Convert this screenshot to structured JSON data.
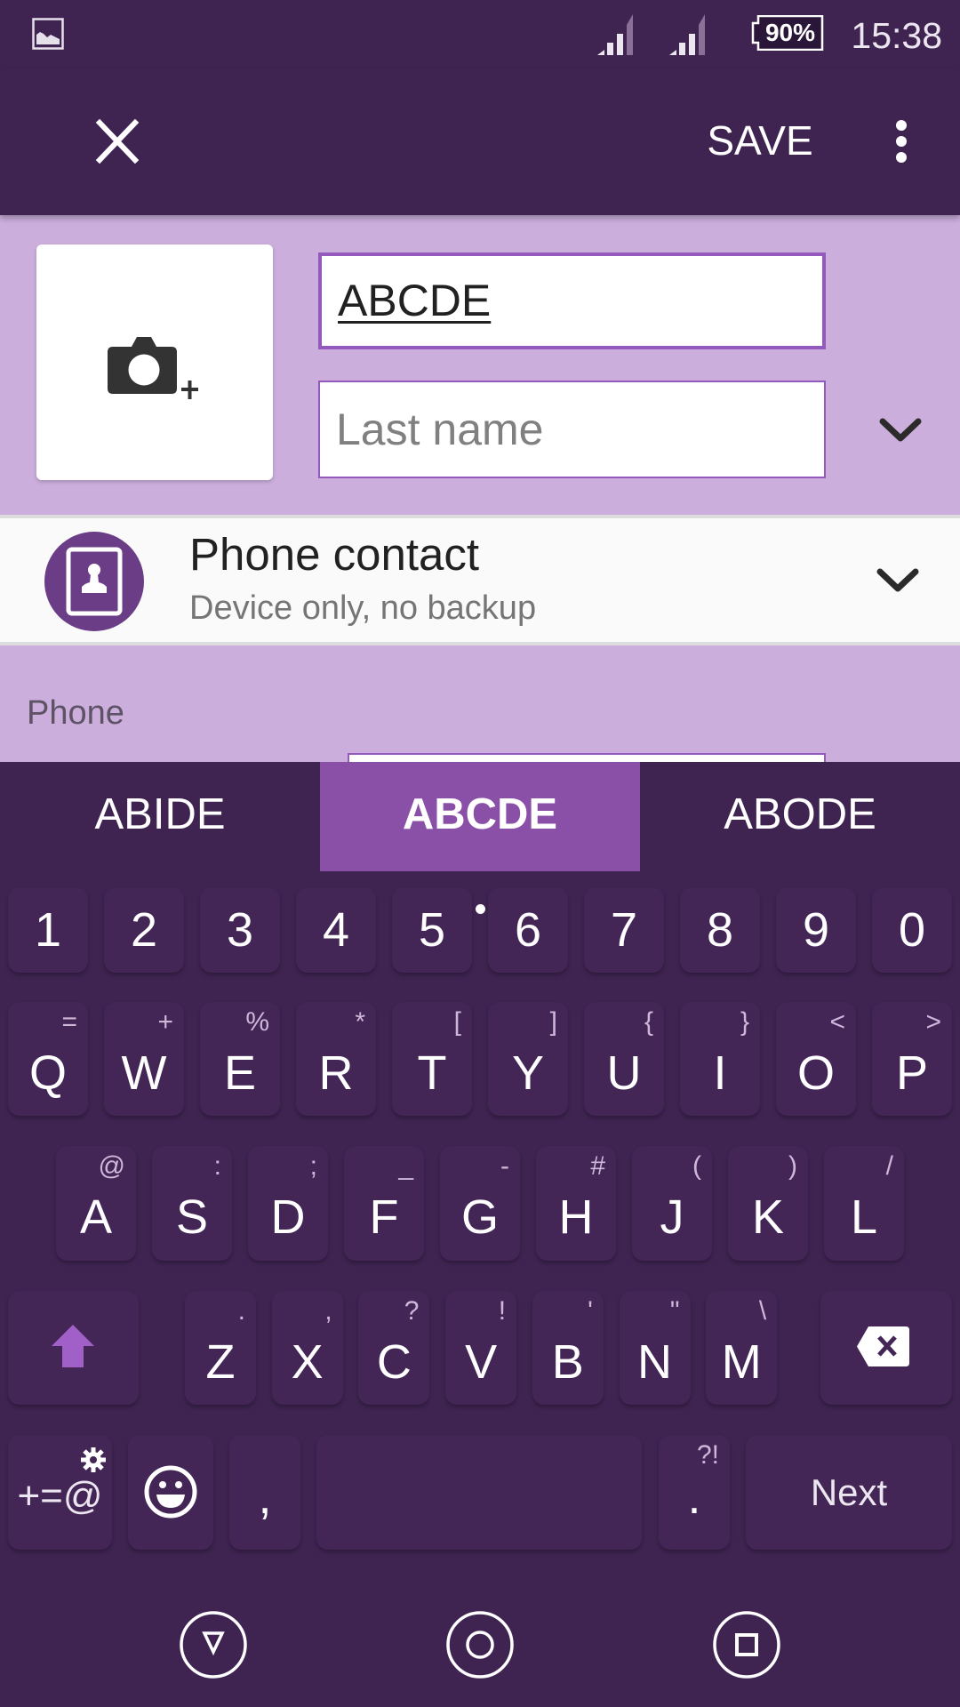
{
  "status_bar": {
    "battery_percent": "90%",
    "battery_level": 0.9,
    "time": "15:38",
    "icons": [
      "image-notification-icon",
      "signal-sim1-icon",
      "signal-sim2-icon",
      "battery-icon"
    ]
  },
  "toolbar": {
    "close_icon": "close-icon",
    "save_label": "SAVE",
    "menu_icon": "more-vert-icon"
  },
  "contact_form": {
    "photo_icon": "add-photo-camera-icon",
    "first_name_value": "ABCDE",
    "last_name_placeholder": "Last name",
    "last_name_value": "",
    "expand_icon": "chevron-down-icon"
  },
  "account": {
    "icon": "phone-contact-icon",
    "title": "Phone contact",
    "subtitle": "Device only, no backup",
    "expand_icon": "chevron-down-icon"
  },
  "phone_section": {
    "label": "Phone"
  },
  "keyboard": {
    "suggestions": [
      {
        "label": "ABIDE",
        "active": false
      },
      {
        "label": "ABCDE",
        "active": true
      },
      {
        "label": "ABODE",
        "active": false
      }
    ],
    "number_row": [
      "1",
      "2",
      "3",
      "4",
      "5",
      "6",
      "7",
      "8",
      "9",
      "0"
    ],
    "row1": [
      {
        "key": "Q",
        "alt": "="
      },
      {
        "key": "W",
        "alt": "+"
      },
      {
        "key": "E",
        "alt": "%"
      },
      {
        "key": "R",
        "alt": "*"
      },
      {
        "key": "T",
        "alt": "["
      },
      {
        "key": "Y",
        "alt": "]"
      },
      {
        "key": "U",
        "alt": "{"
      },
      {
        "key": "I",
        "alt": "}"
      },
      {
        "key": "O",
        "alt": "<"
      },
      {
        "key": "P",
        "alt": ">"
      }
    ],
    "row2": [
      {
        "key": "A",
        "alt": "@"
      },
      {
        "key": "S",
        "alt": ":"
      },
      {
        "key": "D",
        "alt": ";"
      },
      {
        "key": "F",
        "alt": "_"
      },
      {
        "key": "G",
        "alt": "-"
      },
      {
        "key": "H",
        "alt": "#"
      },
      {
        "key": "J",
        "alt": "("
      },
      {
        "key": "K",
        "alt": ")"
      },
      {
        "key": "L",
        "alt": "/"
      }
    ],
    "row3": [
      {
        "key": "Z",
        "alt": "."
      },
      {
        "key": "X",
        "alt": ","
      },
      {
        "key": "C",
        "alt": "?"
      },
      {
        "key": "V",
        "alt": "!"
      },
      {
        "key": "B",
        "alt": "'"
      },
      {
        "key": "N",
        "alt": "\""
      },
      {
        "key": "M",
        "alt": "\\"
      }
    ],
    "shift_icon": "shift-icon",
    "backspace_icon": "backspace-icon",
    "symbols_label": "+=@",
    "settings_icon": "gear-icon",
    "emoji_icon": "emoji-icon",
    "comma_label": ",",
    "period_label": ".",
    "period_alt": "?!",
    "action_label": "Next",
    "accent_color": "#a160c8"
  },
  "nav_bar": {
    "back_icon": "back-icon",
    "home_icon": "home-icon",
    "recents_icon": "recents-icon"
  },
  "colors": {
    "primary_dark": "#3f2452",
    "header_bg": "#cbaedc",
    "field_border": "#9359bc",
    "suggestion_active": "#8a4fa6",
    "account_icon_bg": "#6a3d86"
  }
}
